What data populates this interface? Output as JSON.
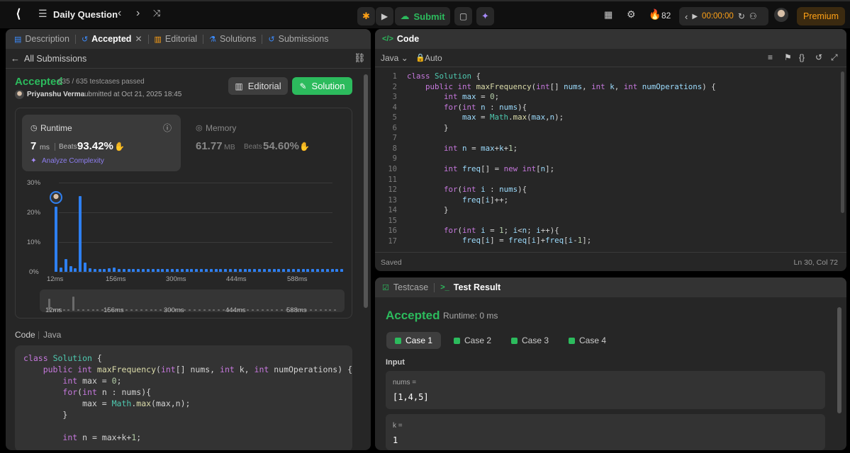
{
  "topbar": {
    "title": "Daily Question",
    "submit_label": "Submit",
    "streak": "82",
    "timer": "00:00:00",
    "premium_label": "Premium"
  },
  "left": {
    "tabs": [
      "Description",
      "Accepted",
      "Editorial",
      "Solutions",
      "Submissions"
    ],
    "all_submissions": "All Submissions",
    "status": "Accepted",
    "testcases": "635 / 635 testcases passed",
    "user": "Priyanshu Verma",
    "submitted": "submitted at Oct 21, 2025 18:45",
    "editorial_btn": "Editorial",
    "solution_btn": "Solution",
    "runtime": {
      "label": "Runtime",
      "value": "7",
      "unit": "ms",
      "beats_label": "Beats",
      "beats": "93.42%",
      "analyze": "Analyze Complexity"
    },
    "memory": {
      "label": "Memory",
      "value": "61.77",
      "unit": "MB",
      "beats_label": "Beats",
      "beats": "54.60%"
    },
    "code_label": "Code",
    "lang_label": "Java",
    "code_lines": [
      "class Solution {",
      "    public int maxFrequency(int[] nums, int k, int numOperations) {",
      "        int max = 0;",
      "        for(int n : nums){",
      "            max = Math.max(max,n);",
      "        }",
      "",
      "        int n = max+k+1;"
    ]
  },
  "chart_data": {
    "type": "bar",
    "title": "",
    "xlabel": "",
    "ylabel": "",
    "ylim": [
      0,
      30
    ],
    "y_ticks": [
      "30%",
      "20%",
      "10%",
      "0%"
    ],
    "x_ticks": [
      "12ms",
      "156ms",
      "300ms",
      "444ms",
      "588ms"
    ],
    "values": [
      21.8,
      1.5,
      4.2,
      2.0,
      1.3,
      25.5,
      3.0,
      1.2,
      1.0,
      1.0,
      1.0,
      1.2,
      1.5,
      1.0,
      1.0,
      1.0,
      1.0,
      1.0,
      1.0,
      1.0,
      1.0,
      1.0,
      1.0,
      1.0,
      1.0,
      1.0,
      1.0,
      1.0,
      1.0,
      1.0,
      1.0,
      1.0,
      1.0,
      1.0,
      1.0,
      1.0,
      1.0,
      1.0,
      1.0,
      1.0,
      1.0,
      1.0,
      1.0,
      1.0,
      1.0,
      1.0,
      1.0,
      1.0,
      1.0,
      1.0,
      1.0,
      1.0,
      1.0,
      1.0,
      1.0,
      1.0,
      1.0,
      1.0,
      1.0,
      1.0
    ],
    "highlight_index": 0,
    "accent": "#2e7ff1"
  },
  "editor": {
    "title": "Code",
    "lang": "Java",
    "mode": "Auto",
    "saved": "Saved",
    "cursor": "Ln 30, Col 72",
    "lines": [
      "1",
      "2",
      "3",
      "4",
      "5",
      "6",
      "7",
      "8",
      "9",
      "10",
      "11",
      "12",
      "13",
      "14",
      "15",
      "16",
      "17"
    ]
  },
  "result": {
    "tab1": "Testcase",
    "tab2": "Test Result",
    "status": "Accepted",
    "runtime": "Runtime: 0 ms",
    "cases": [
      "Case 1",
      "Case 2",
      "Case 3",
      "Case 4"
    ],
    "input_label": "Input",
    "nums_label": "nums =",
    "nums_value": "[1,4,5]",
    "k_label": "k =",
    "k_value": "1"
  },
  "colors": {
    "accepted": "#2cbb5d",
    "orange": "#ffa116",
    "blue": "#2e7ff1"
  }
}
